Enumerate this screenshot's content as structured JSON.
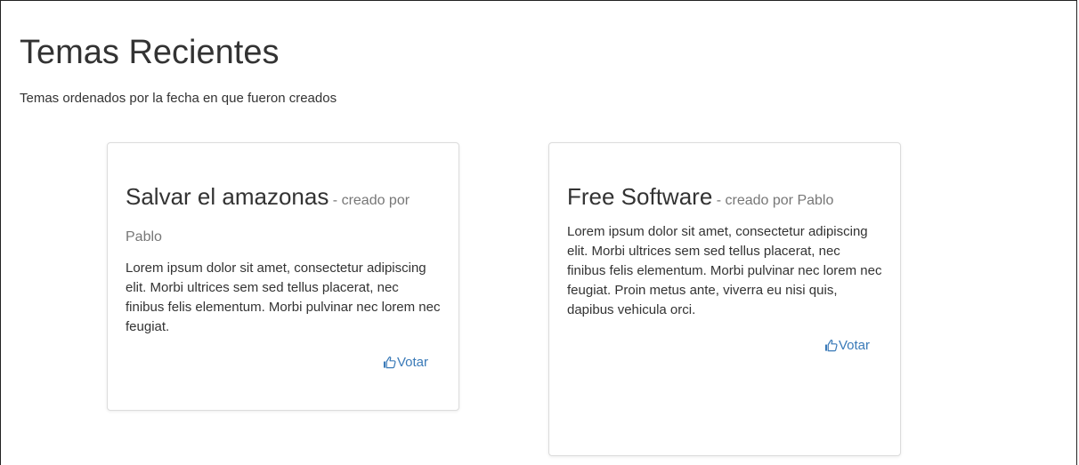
{
  "header": {
    "title": "Temas Recientes",
    "subtitle": "Temas ordenados por la fecha en que fueron creados"
  },
  "topics": [
    {
      "title": "Salvar el amazonas",
      "author_text": " - creado por Pablo",
      "body": "Lorem ipsum dolor sit amet, consectetur adipiscing elit. Morbi ultrices sem sed tellus placerat, nec finibus felis elementum. Morbi pulvinar nec lorem nec feugiat.",
      "vote_label": "Votar",
      "vote_icon": "thumbs-up-icon"
    },
    {
      "title": "Free Software",
      "author_text": " - creado por Pablo",
      "body": "Lorem ipsum dolor sit amet, consectetur adipiscing elit. Morbi ultrices sem sed tellus placerat, nec finibus felis elementum. Morbi pulvinar nec lorem nec feugiat. Proin metus ante, viverra eu nisi quis, dapibus vehicula orci.",
      "vote_label": "Votar",
      "vote_icon": "thumbs-up-icon"
    }
  ],
  "colors": {
    "link": "#3a7ab8",
    "muted": "#777777",
    "text": "#333333",
    "card_border": "#dcdcdc"
  }
}
